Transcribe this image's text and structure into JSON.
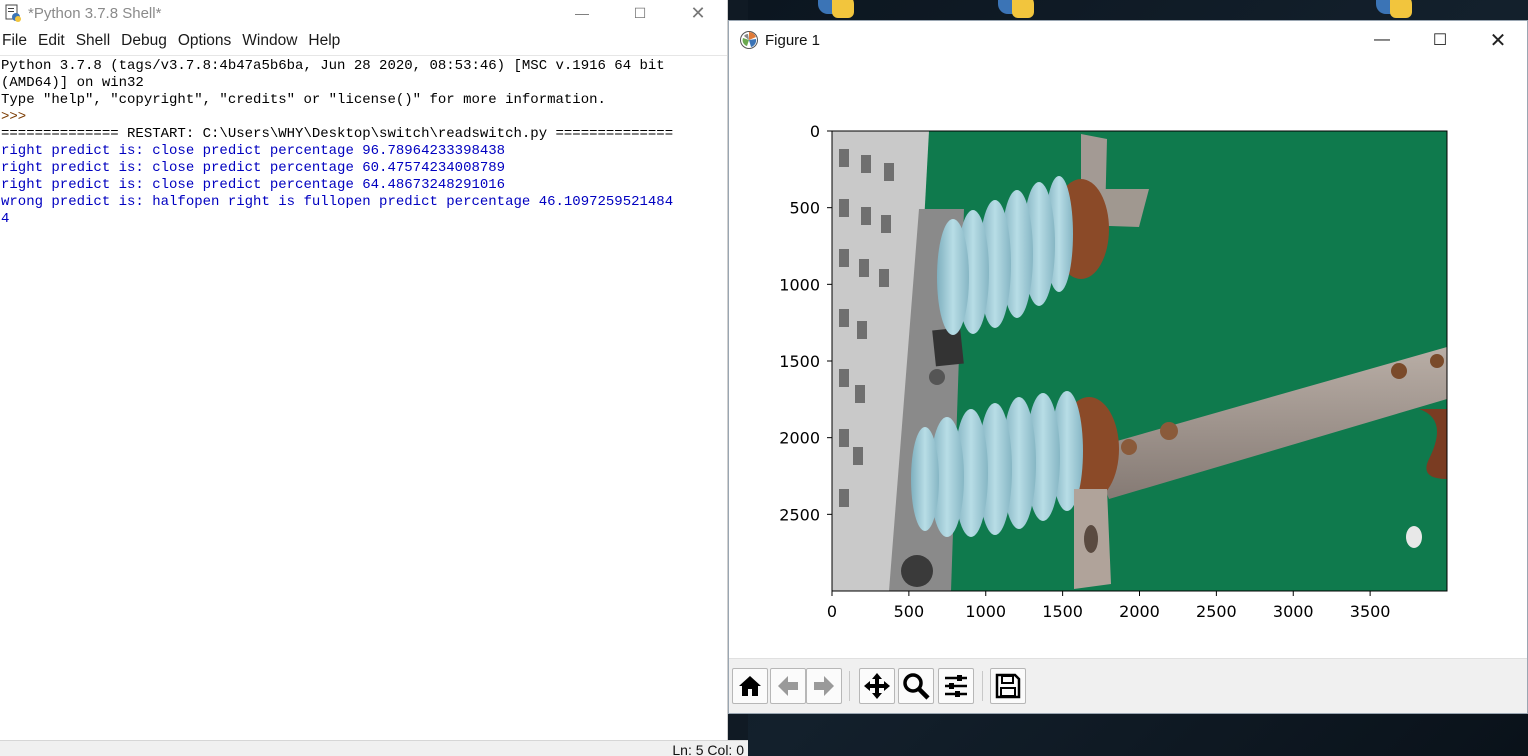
{
  "shell": {
    "title": "*Python 3.7.8 Shell*",
    "menu": [
      "File",
      "Edit",
      "Shell",
      "Debug",
      "Options",
      "Window",
      "Help"
    ],
    "console": {
      "banner1": "Python 3.7.8 (tags/v3.7.8:4b47a5b6ba, Jun 28 2020, 08:53:46) [MSC v.1916 64 bit",
      "banner2": "(AMD64)] on win32",
      "banner3": "Type \"help\", \"copyright\", \"credits\" or \"license()\" for more information.",
      "prompt": ">>> ",
      "restart": "============== RESTART: C:\\Users\\WHY\\Desktop\\switch\\readswitch.py ==============",
      "outputs": [
        "right predict is: close predict percentage 96.78964233398438",
        "right predict is: close predict percentage 60.47574234008789",
        "right predict is: close predict percentage 64.48673248291016",
        "wrong predict is: halfopen right is fullopen predict percentage 46.1097259521484",
        "4"
      ]
    },
    "status": "Ln: 5  Col: 0"
  },
  "figure": {
    "title": "Figure 1",
    "xticks": [
      "0",
      "500",
      "1000",
      "1500",
      "2000",
      "2500",
      "3000",
      "3500"
    ],
    "yticks": [
      "0",
      "500",
      "1000",
      "1500",
      "2000",
      "2500"
    ],
    "toolbar": [
      "home-icon",
      "back-arrow-icon",
      "forward-arrow-icon",
      "pan-move-icon",
      "zoom-magnifier-icon",
      "subplots-config-icon",
      "save-disk-icon"
    ]
  },
  "chart_data": {
    "type": "image",
    "title": "",
    "xlabel": "",
    "ylabel": "",
    "xlim": [
      0,
      4000
    ],
    "ylim": [
      3000,
      0
    ],
    "x_tick_values": [
      0,
      500,
      1000,
      1500,
      2000,
      2500,
      3000,
      3500
    ],
    "y_tick_values": [
      0,
      500,
      1000,
      1500,
      2000,
      2500
    ],
    "grid": false
  },
  "colors": {
    "shell_output": "#0000c0",
    "green_panel": "#0e7a4c",
    "insulator": "#9cc6d2",
    "rust": "#8a4a2a"
  }
}
